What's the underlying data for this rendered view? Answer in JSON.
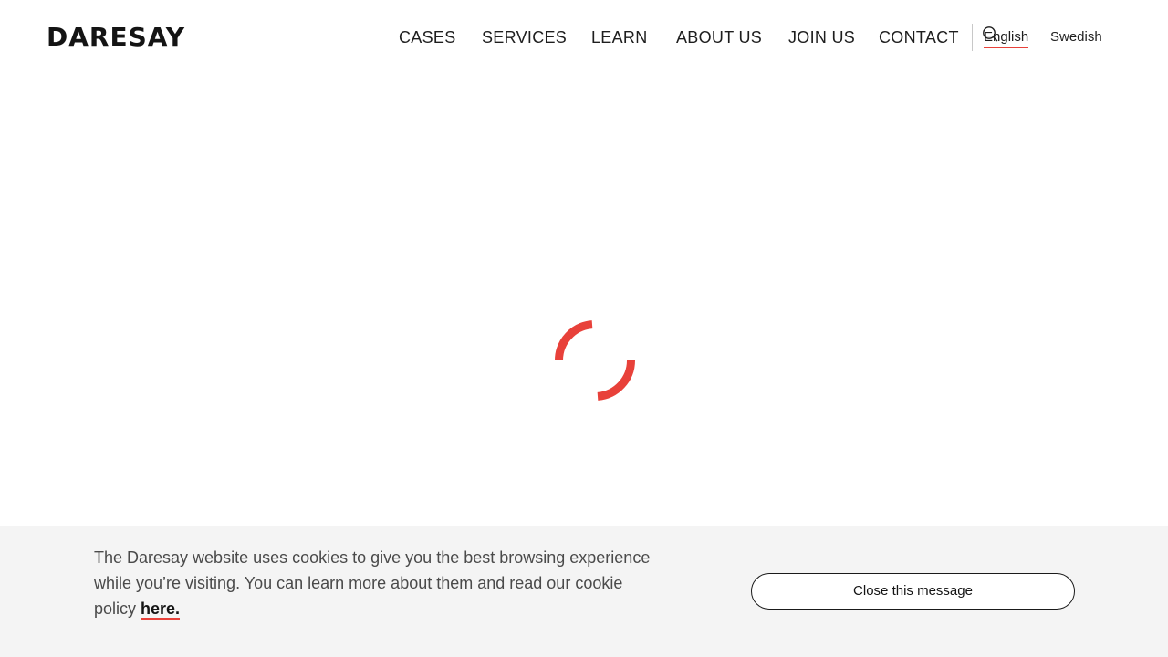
{
  "header": {
    "logo": "DARESAY",
    "nav": [
      {
        "label": "CASES",
        "name": "nav-cases"
      },
      {
        "label": "SERVICES",
        "name": "nav-services"
      },
      {
        "label": "LEARN",
        "name": "nav-learn"
      },
      {
        "label": "ABOUT US",
        "name": "nav-about-us"
      },
      {
        "label": "JOIN US",
        "name": "nav-join-us"
      },
      {
        "label": "CONTACT",
        "name": "nav-contact"
      }
    ],
    "search_icon": "search-icon",
    "languages": {
      "english": "English",
      "swedish": "Swedish",
      "active": "English"
    }
  },
  "main": {
    "loading_indicator": "spinner",
    "spinner_color": "#e8413a"
  },
  "cookie_banner": {
    "text": "The Daresay website uses cookies to give you the best browsing experience while you’re visiting. You can learn more about them and read our cookie policy ",
    "link_label": "here.",
    "close_label": "Close this message"
  },
  "colors": {
    "accent": "#e8413a",
    "banner_bg": "#f4f4f4",
    "text": "#1a1a1a"
  }
}
